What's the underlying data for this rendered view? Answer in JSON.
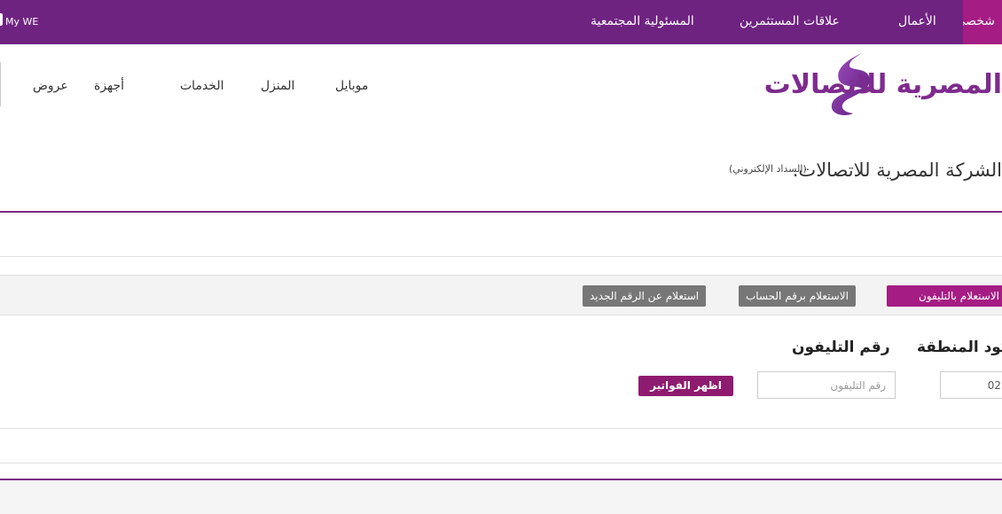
{
  "topbar": {
    "my_we": "My WE",
    "nav": {
      "personal": "شخصي",
      "business": "الأعمال",
      "investor_relations": "علاقات المستثمرين",
      "csr": "المسئولية المجتمعية"
    },
    "colors": {
      "bar": "#6f2381",
      "active": "#a51c84"
    }
  },
  "logo": {
    "text": "المصرية للاتصالات",
    "icon": "we-swoosh-icon"
  },
  "main_nav": {
    "mobile": "موبايل",
    "home": "المنزل",
    "services": "الخدمات",
    "devices": "أجهزة",
    "offers": "عروض"
  },
  "page": {
    "title": "الشركة المصرية للاتصالات.",
    "subtitle": "(السداد الإلكتروني)"
  },
  "tabs": {
    "by_phone": "الاستعلام بالتليفون",
    "by_account": "الاستعلام برقم الحساب",
    "new_number": "استعلام عن الرقم الجديد"
  },
  "form": {
    "area_code_label": "كود المنطقة",
    "phone_label": "رقم التليفون",
    "area_code_value": "02",
    "phone_placeholder": "رقم التليفون",
    "submit_label": "اظهر الفواتير"
  },
  "colors": {
    "accent": "#a51c84",
    "brand": "#7e2b8d",
    "tab_inactive": "#777777",
    "button": "#8e1b6f"
  }
}
